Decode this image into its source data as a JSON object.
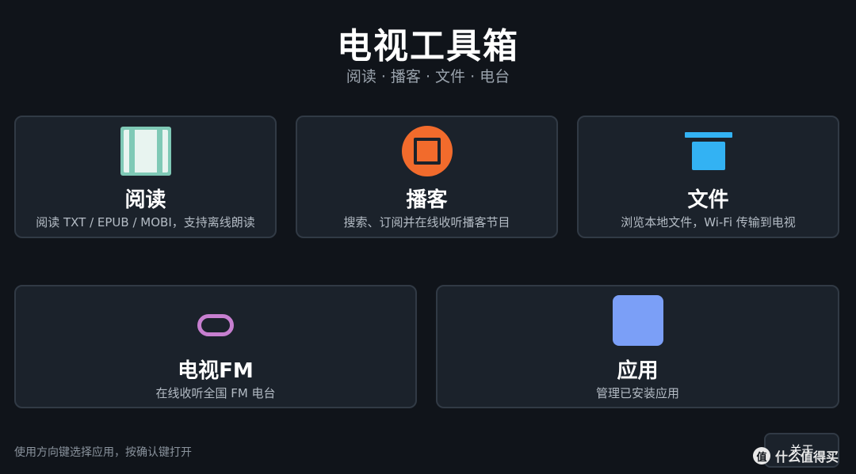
{
  "header": {
    "title": "电视工具箱",
    "subtitle": "阅读 · 播客 · 文件 · 电台"
  },
  "cards": {
    "read": {
      "title": "阅读",
      "desc": "阅读 TXT / EPUB / MOBI，支持离线朗读",
      "icon": "book-icon",
      "accent": "#7fc9b6"
    },
    "podcast": {
      "title": "播客",
      "desc": "搜索、订阅并在线收听播客节目",
      "icon": "podcast-icon",
      "accent": "#f26b2c"
    },
    "files": {
      "title": "文件",
      "desc": "浏览本地文件，Wi-Fi 传输到电视",
      "icon": "folder-icon",
      "accent": "#33b2f3"
    },
    "fm": {
      "title": "电视FM",
      "desc": "在线收听全国 FM 电台",
      "icon": "radio-icon",
      "accent": "#c77fd0"
    },
    "apps": {
      "title": "应用",
      "desc": "管理已安装应用",
      "icon": "apps-icon",
      "accent": "#7b9ff7"
    }
  },
  "footer": {
    "hint": "使用方向键选择应用，按确认键打开",
    "about_label": "关于"
  },
  "watermark": {
    "logo_text": "值",
    "text": "什么值得买"
  },
  "colors": {
    "background": "#10141a",
    "card_background": "#1b222b",
    "card_border": "#313a45"
  }
}
